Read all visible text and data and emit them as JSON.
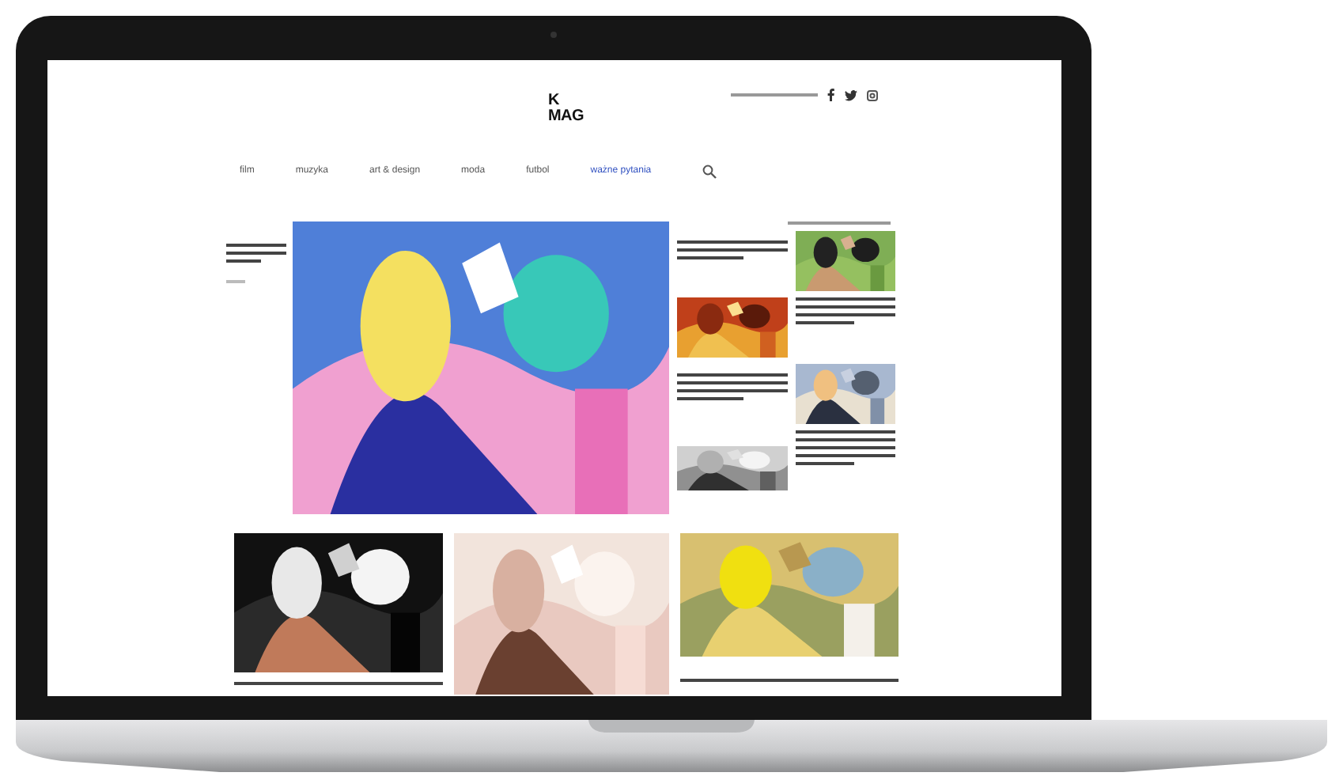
{
  "logo": {
    "lines": [
      "K",
      "MAG"
    ]
  },
  "nav": [
    {
      "label": "film",
      "highlighted": false
    },
    {
      "label": "muzyka",
      "highlighted": false
    },
    {
      "label": "art & design",
      "highlighted": false
    },
    {
      "label": "moda",
      "highlighted": false
    },
    {
      "label": "futbol",
      "highlighted": false
    },
    {
      "label": "ważne pytania",
      "highlighted": true
    }
  ]
}
